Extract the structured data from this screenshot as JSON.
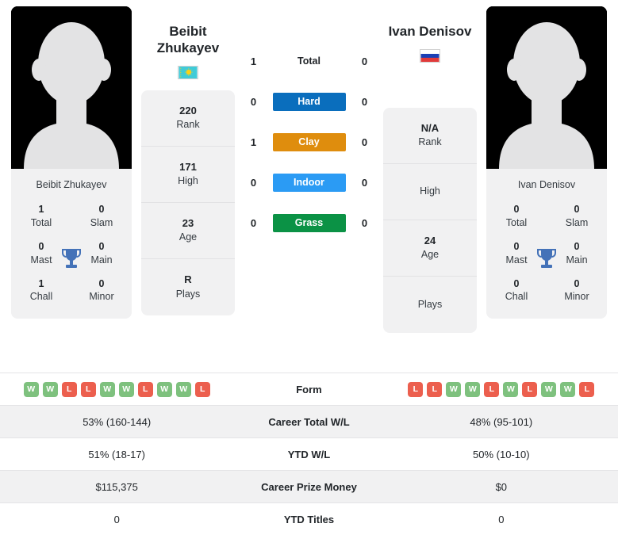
{
  "players": {
    "left": {
      "display_name": "Beibit Zhukayev",
      "header_name_line1": "Beibit",
      "header_name_line2": "Zhukayev",
      "flag": "kazakhstan-flag",
      "titles": {
        "total_value": "1",
        "total_label": "Total",
        "slam_value": "0",
        "slam_label": "Slam",
        "mast_value": "0",
        "mast_label": "Mast",
        "main_value": "0",
        "main_label": "Main",
        "chall_value": "1",
        "chall_label": "Chall",
        "minor_value": "0",
        "minor_label": "Minor"
      },
      "info": [
        {
          "value": "220",
          "label": "Rank"
        },
        {
          "value": "171",
          "label": "High"
        },
        {
          "value": "23",
          "label": "Age"
        },
        {
          "value": "R",
          "label": "Plays"
        }
      ],
      "form": [
        "W",
        "W",
        "L",
        "L",
        "W",
        "W",
        "L",
        "W",
        "W",
        "L"
      ],
      "surface_wins": {
        "total": "1",
        "hard": "0",
        "clay": "1",
        "indoor": "0",
        "grass": "0"
      },
      "career_total_wl": "53% (160-144)",
      "ytd_wl": "51% (18-17)",
      "career_prize_money": "$115,375",
      "ytd_titles": "0"
    },
    "right": {
      "display_name": "Ivan Denisov",
      "header_name_line1": "Ivan Denisov",
      "header_name_line2": "",
      "flag": "russia-flag",
      "titles": {
        "total_value": "0",
        "total_label": "Total",
        "slam_value": "0",
        "slam_label": "Slam",
        "mast_value": "0",
        "mast_label": "Mast",
        "main_value": "0",
        "main_label": "Main",
        "chall_value": "0",
        "chall_label": "Chall",
        "minor_value": "0",
        "minor_label": "Minor"
      },
      "info": [
        {
          "value": "N/A",
          "label": "Rank"
        },
        {
          "value": "",
          "label": "High"
        },
        {
          "value": "24",
          "label": "Age"
        },
        {
          "value": "",
          "label": "Plays"
        }
      ],
      "form": [
        "L",
        "L",
        "W",
        "W",
        "L",
        "W",
        "L",
        "W",
        "W",
        "L"
      ],
      "surface_wins": {
        "total": "0",
        "hard": "0",
        "clay": "0",
        "indoor": "0",
        "grass": "0"
      },
      "career_total_wl": "48% (95-101)",
      "ytd_wl": "50% (10-10)",
      "career_prize_money": "$0",
      "ytd_titles": "0"
    }
  },
  "surfaces": [
    {
      "key": "total",
      "label": "Total",
      "color": "transparent",
      "text_color": "#212529"
    },
    {
      "key": "hard",
      "label": "Hard",
      "color": "#0a6ebd",
      "text_color": "#ffffff"
    },
    {
      "key": "clay",
      "label": "Clay",
      "color": "#df8d0d",
      "text_color": "#ffffff"
    },
    {
      "key": "indoor",
      "label": "Indoor",
      "color": "#2b9bf4",
      "text_color": "#ffffff"
    },
    {
      "key": "grass",
      "label": "Grass",
      "color": "#0b9245",
      "text_color": "#ffffff"
    }
  ],
  "stats_rows": [
    {
      "label": "Form",
      "type": "form"
    },
    {
      "label": "Career Total W/L",
      "type": "text",
      "key": "career_total_wl"
    },
    {
      "label": "YTD W/L",
      "type": "text",
      "key": "ytd_wl"
    },
    {
      "label": "Career Prize Money",
      "type": "text",
      "key": "career_prize_money"
    },
    {
      "label": "YTD Titles",
      "type": "text",
      "key": "ytd_titles"
    }
  ],
  "labels": {
    "form": "Form",
    "career_total_wl": "Career Total W/L",
    "ytd_wl": "YTD W/L",
    "career_prize_money": "Career Prize Money",
    "ytd_titles": "YTD Titles"
  },
  "colors": {
    "hard": "#0a6ebd",
    "clay": "#df8d0d",
    "indoor": "#2b9bf4",
    "grass": "#0b9245",
    "win_badge": "#7ec17e",
    "loss_badge": "#ec5f4e",
    "card_bg": "#f1f1f2",
    "trophy": "#4472b8"
  }
}
